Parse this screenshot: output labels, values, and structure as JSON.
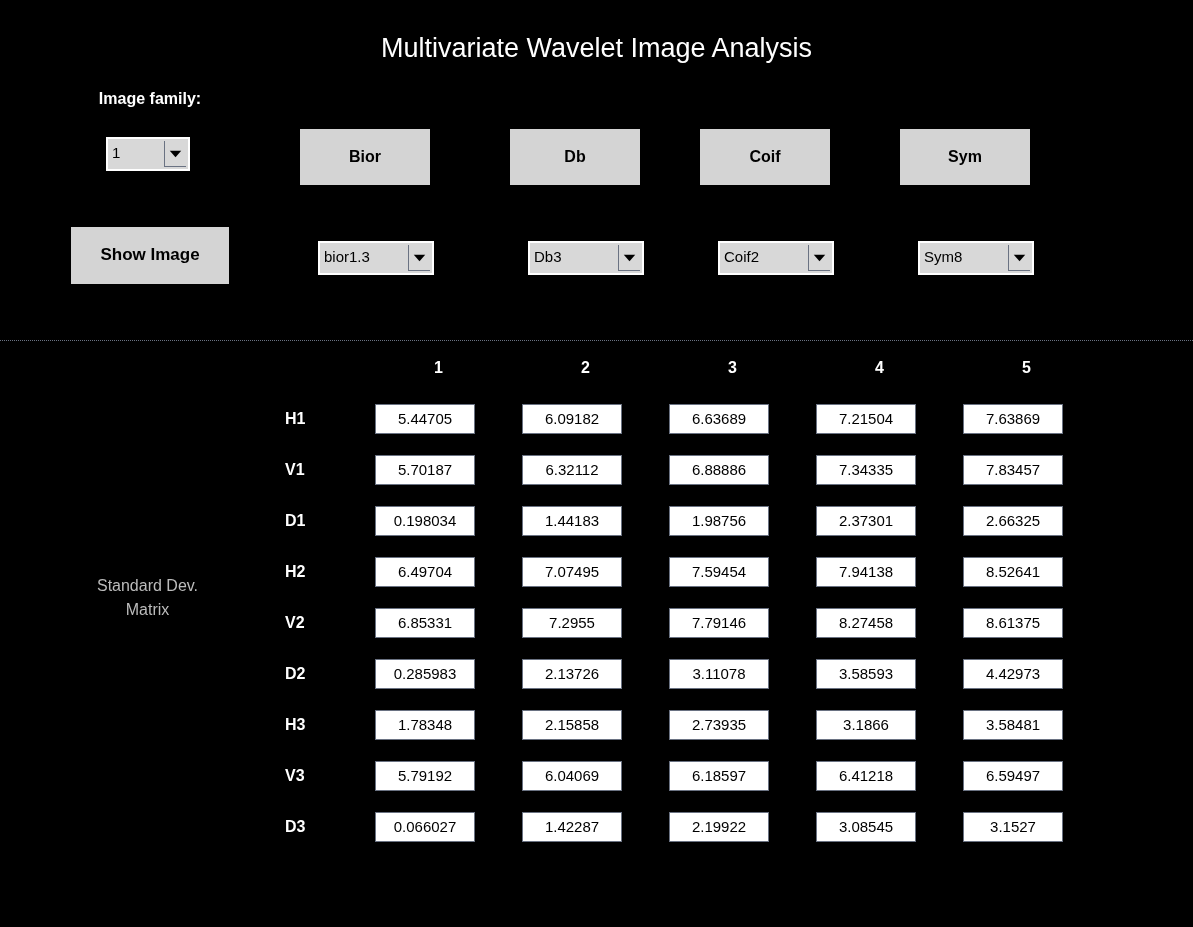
{
  "title": "Multivariate Wavelet Image Analysis",
  "image_family": {
    "label": "Image family:",
    "value": "1"
  },
  "show_image_button": "Show Image",
  "wavelet_buttons": [
    "Bior",
    "Db",
    "Coif",
    "Sym"
  ],
  "wavelet_dropdowns": [
    "bior1.3",
    "Db3",
    "Coif2",
    "Sym8"
  ],
  "matrix": {
    "label": "Standard Dev. Matrix",
    "columns": [
      "1",
      "2",
      "3",
      "4",
      "5"
    ],
    "rows": [
      {
        "label": "H1",
        "values": [
          "5.44705",
          "6.09182",
          "6.63689",
          "7.21504",
          "7.63869"
        ]
      },
      {
        "label": "V1",
        "values": [
          "5.70187",
          "6.32112",
          "6.88886",
          "7.34335",
          "7.83457"
        ]
      },
      {
        "label": "D1",
        "values": [
          "0.198034",
          "1.44183",
          "1.98756",
          "2.37301",
          "2.66325"
        ]
      },
      {
        "label": "H2",
        "values": [
          "6.49704",
          "7.07495",
          "7.59454",
          "7.94138",
          "8.52641"
        ]
      },
      {
        "label": "V2",
        "values": [
          "6.85331",
          "7.2955",
          "7.79146",
          "8.27458",
          "8.61375"
        ]
      },
      {
        "label": "D2",
        "values": [
          "0.285983",
          "2.13726",
          "3.11078",
          "3.58593",
          "4.42973"
        ]
      },
      {
        "label": "H3",
        "values": [
          "1.78348",
          "2.15858",
          "2.73935",
          "3.1866",
          "3.58481"
        ]
      },
      {
        "label": "V3",
        "values": [
          "5.79192",
          "6.04069",
          "6.18597",
          "6.41218",
          "6.59497"
        ]
      },
      {
        "label": "D3",
        "values": [
          "0.066027",
          "1.42287",
          "2.19922",
          "3.08545",
          "3.1527"
        ]
      }
    ]
  }
}
